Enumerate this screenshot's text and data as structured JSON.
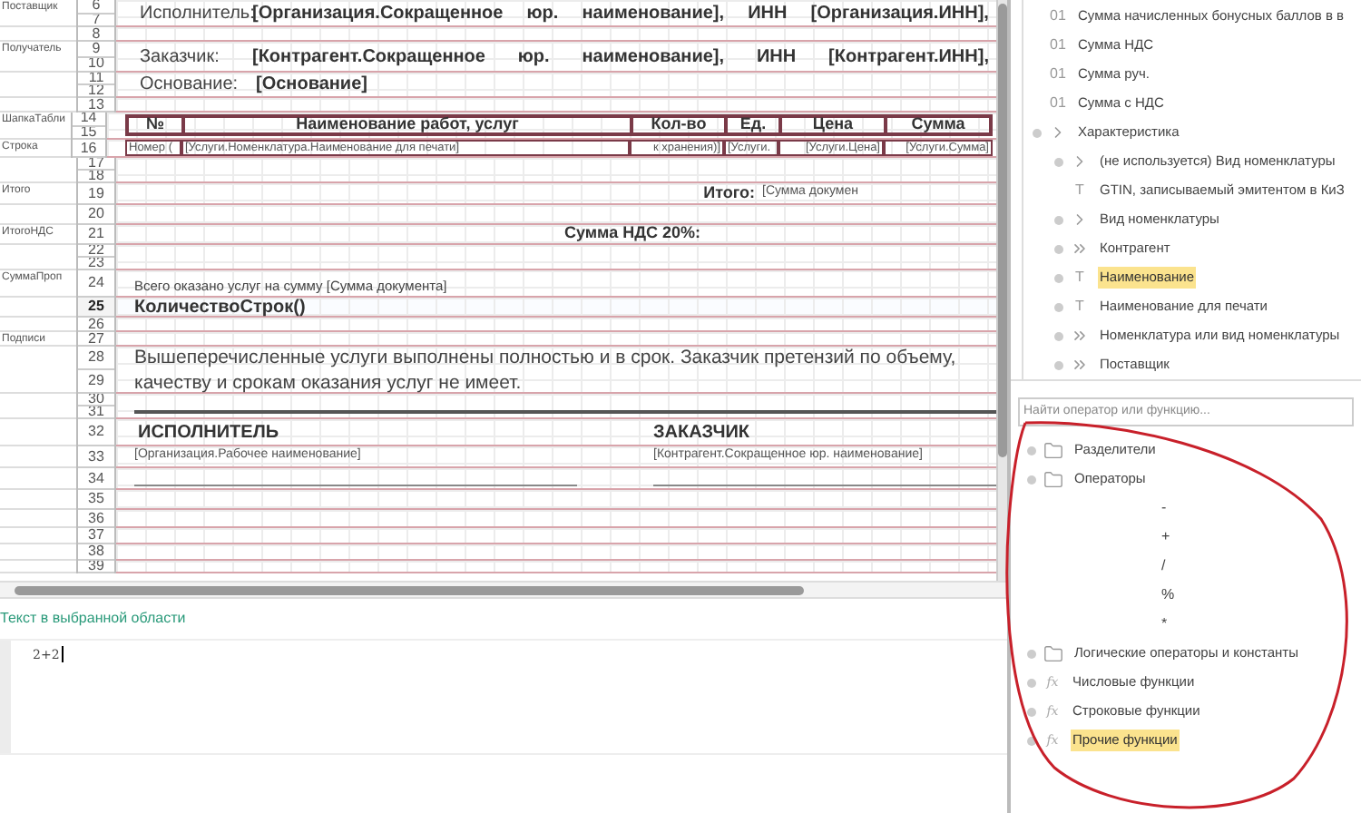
{
  "sheet": {
    "bands": [
      {
        "numbers": [
          "6",
          "7"
        ],
        "section": "Поставщик",
        "selected": false,
        "kind": "party",
        "label": "Исполнитель:",
        "parts": [
          "[Организация.Сокращенное",
          "юр.",
          "наименование],",
          "ИНН",
          "[Организация.ИНН],"
        ]
      },
      {
        "numbers": [
          "8"
        ],
        "selected": false,
        "kind": "empty"
      },
      {
        "numbers": [
          "9",
          "10"
        ],
        "section": "Получатель",
        "selected": false,
        "kind": "party",
        "label": "Заказчик:",
        "parts": [
          "[Контрагент.Сокращенное",
          "юр.",
          "наименование],",
          "ИНН",
          "[Контрагент.ИНН],"
        ]
      },
      {
        "numbers": [
          "11",
          "12"
        ],
        "selected": false,
        "kind": "field",
        "label": "Основание:",
        "value": "[Основание]"
      },
      {
        "numbers": [
          "13"
        ],
        "selected": false,
        "kind": "empty"
      },
      {
        "numbers": [
          "14",
          "15"
        ],
        "section": "ШапкаТабли",
        "selected": false,
        "kind": "table_header",
        "cells": [
          "№",
          "Наименование работ, услуг",
          "Кол-во",
          "Ед.",
          "Цена",
          "Сумма"
        ]
      },
      {
        "numbers": [
          "16"
        ],
        "section": "Строка",
        "selected": false,
        "kind": "table_row",
        "cells": [
          "Номер (",
          "[Услуги.Номенклатура.Наименование для печати]",
          "к хранения)]",
          "[Услуги.",
          "[Услуги.Цена]",
          "[Услуги.Сумма]"
        ]
      },
      {
        "numbers": [
          "17",
          "18"
        ],
        "selected": false,
        "kind": "empty"
      },
      {
        "numbers": [
          "19"
        ],
        "section": "Итого",
        "selected": false,
        "kind": "total",
        "label": "Итого:",
        "value": "[Сумма докумен"
      },
      {
        "numbers": [
          "20"
        ],
        "selected": false,
        "kind": "empty"
      },
      {
        "numbers": [
          "21"
        ],
        "section": "ИтогоНДС",
        "selected": false,
        "kind": "total",
        "label": "Сумма НДС 20%:"
      },
      {
        "numbers": [
          "22",
          "23"
        ],
        "selected": false,
        "kind": "empty"
      },
      {
        "numbers": [
          "24"
        ],
        "section": "СуммаПроп",
        "selected": false,
        "kind": "text",
        "text": "Всего оказано услуг на сумму [Сумма документа]"
      },
      {
        "numbers": [
          "25"
        ],
        "selected": true,
        "kind": "bold",
        "text": "КоличествоСтрок()"
      },
      {
        "numbers": [
          "26"
        ],
        "selected": false,
        "kind": "empty"
      },
      {
        "numbers": [
          "27"
        ],
        "section": "Подписи",
        "selected": false,
        "kind": "empty"
      },
      {
        "numbers": [
          "28",
          "29"
        ],
        "selected": false,
        "kind": "paragraph",
        "text": "Вышеперечисленные услуги выполнены полностью и в срок. Заказчик претензий по объему, качеству и срокам оказания услуг не имеет."
      },
      {
        "numbers": [
          "30",
          "31"
        ],
        "selected": false,
        "kind": "rule"
      },
      {
        "numbers": [
          "32"
        ],
        "selected": false,
        "kind": "signature_header",
        "left": "ИСПОЛНИТЕЛЬ",
        "right": "ЗАКАЗЧИК"
      },
      {
        "numbers": [
          "33"
        ],
        "selected": false,
        "kind": "signature_name",
        "left": "[Организация.Рабочее наименование]",
        "right": "[Контрагент.Сокращенное юр. наименование]"
      },
      {
        "numbers": [
          "34"
        ],
        "selected": false,
        "kind": "signature_line"
      },
      {
        "numbers": [
          "35"
        ],
        "selected": false,
        "kind": "empty"
      },
      {
        "numbers": [
          "36"
        ],
        "selected": false,
        "kind": "empty"
      },
      {
        "numbers": [
          "37"
        ],
        "selected": false,
        "kind": "empty"
      },
      {
        "numbers": [
          "38"
        ],
        "selected": false,
        "kind": "empty"
      },
      {
        "numbers": [
          "39"
        ],
        "selected": false,
        "kind": "empty"
      }
    ]
  },
  "editor": {
    "label": "Текст в выбранной области",
    "value": "2+2"
  },
  "fields_tree": [
    {
      "kind": "number",
      "glyph": "01",
      "label": "Сумма начисленных бонусных баллов в в",
      "expandable": false,
      "selected": false
    },
    {
      "kind": "number",
      "glyph": "01",
      "label": "Сумма НДС",
      "expandable": false,
      "selected": false
    },
    {
      "kind": "number",
      "glyph": "01",
      "label": "Сумма руч.",
      "expandable": false,
      "selected": false
    },
    {
      "kind": "number",
      "glyph": "01",
      "label": "Сумма с НДС",
      "expandable": false,
      "selected": false
    },
    {
      "kind": "ref",
      "label": "Характеристика",
      "expandable": true,
      "selected": false,
      "children": [
        {
          "kind": "ref",
          "label": "(не используется) Вид номенклатуры",
          "expandable": true,
          "selected": false
        },
        {
          "kind": "string",
          "glyph": "T",
          "label": "GTIN, записываемый эмитентом в КиЗ",
          "expandable": false,
          "selected": false
        },
        {
          "kind": "ref",
          "label": "Вид номенклатуры",
          "expandable": true,
          "selected": false
        },
        {
          "kind": "composite",
          "label": "Контрагент",
          "expandable": true,
          "selected": false
        },
        {
          "kind": "string",
          "glyph": "T",
          "label": "Наименование",
          "expandable": true,
          "selected": true
        },
        {
          "kind": "string",
          "glyph": "T",
          "label": "Наименование для печати",
          "expandable": true,
          "selected": false
        },
        {
          "kind": "composite",
          "label": "Номенклатура или вид номенклатуры",
          "expandable": true,
          "selected": false
        },
        {
          "kind": "composite",
          "label": "Поставщик",
          "expandable": true,
          "selected": false
        }
      ]
    }
  ],
  "search": {
    "placeholder": "Найти оператор или функцию..."
  },
  "operators_tree": [
    {
      "kind": "folder",
      "label": "Разделители",
      "expandable": true,
      "selected": false
    },
    {
      "kind": "folder",
      "label": "Операторы",
      "expandable": true,
      "selected": false,
      "children": [
        {
          "kind": "operator",
          "label": "-",
          "selected": false
        },
        {
          "kind": "operator",
          "label": "+",
          "selected": false
        },
        {
          "kind": "operator",
          "label": "/",
          "selected": false
        },
        {
          "kind": "operator",
          "label": "%",
          "selected": false
        },
        {
          "kind": "operator",
          "label": "*",
          "selected": false
        }
      ]
    },
    {
      "kind": "folder",
      "label": "Логические операторы и константы",
      "expandable": true,
      "selected": false
    },
    {
      "kind": "function",
      "glyph": "fx",
      "label": "Числовые функции",
      "expandable": true,
      "selected": false
    },
    {
      "kind": "function",
      "glyph": "fx",
      "label": "Строковые функции",
      "expandable": true,
      "selected": false
    },
    {
      "kind": "function",
      "glyph": "fx",
      "label": "Прочие функции",
      "expandable": true,
      "selected": true
    }
  ]
}
